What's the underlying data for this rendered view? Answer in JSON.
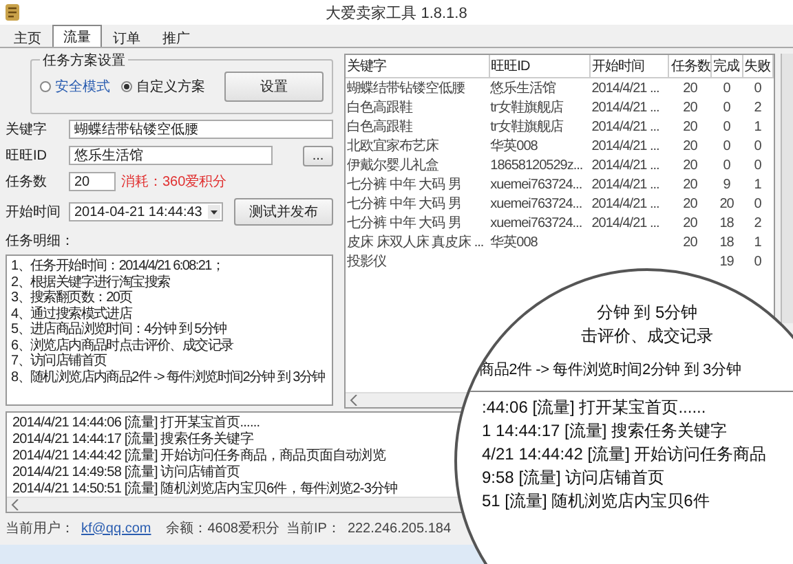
{
  "window": {
    "title": "大爱卖家工具 1.8.1.8"
  },
  "tabs": [
    {
      "label": "主页",
      "selected": false
    },
    {
      "label": "流量",
      "selected": true
    },
    {
      "label": "订单",
      "selected": false
    },
    {
      "label": "推广",
      "selected": false
    }
  ],
  "scheme": {
    "title": "任务方案设置",
    "options": [
      {
        "label": "安全模式",
        "selected": false
      },
      {
        "label": "自定义方案",
        "selected": true
      }
    ],
    "button": "设置"
  },
  "form": {
    "keyword_label": "关键字",
    "keyword": "蝴蝶结带钻镂空低腰",
    "wangwang_label": "旺旺ID",
    "wangwang": "悠乐生活馆",
    "browse_button": "...",
    "count_label": "任务数",
    "count": "20",
    "cost": "消耗：360爱积分",
    "start_label": "开始时间",
    "start_time": "2014-04-21 14:44:43",
    "publish_button": "测试并发布"
  },
  "details": {
    "label": "任务明细：",
    "lines": [
      "1、任务开始时间：2014/4/21 6:08:21；",
      "2、根据关键字进行淘宝搜索",
      "3、搜索翻页数：20页",
      "4、通过搜索模式进店",
      "5、进店商品浏览时间：4分钟 到 5分钟",
      "6、浏览店内商品时点击评价、成交记录",
      "7、访问店铺首页",
      "8、随机浏览店内商品2件 -> 每件浏览时间2分钟 到 3分钟"
    ]
  },
  "table": {
    "columns": [
      "关键字",
      "旺旺ID",
      "开始时间",
      "任务数",
      "完成",
      "失败"
    ],
    "rows": [
      {
        "keyword": "蝴蝶结带钻镂空低腰",
        "wangwang": "悠乐生活馆",
        "start_time": "2014/4/21 ...",
        "tasks": "20",
        "done": "0",
        "failed": "0"
      },
      {
        "keyword": "白色高跟鞋",
        "wangwang": "tr女鞋旗舰店",
        "start_time": "2014/4/21 ...",
        "tasks": "20",
        "done": "0",
        "failed": "2"
      },
      {
        "keyword": "白色高跟鞋",
        "wangwang": "tr女鞋旗舰店",
        "start_time": "2014/4/21 ...",
        "tasks": "20",
        "done": "0",
        "failed": "1"
      },
      {
        "keyword": "北欧宜家布艺床",
        "wangwang": "华英008",
        "start_time": "2014/4/21 ...",
        "tasks": "20",
        "done": "0",
        "failed": "0"
      },
      {
        "keyword": "伊戴尔婴儿礼盒",
        "wangwang": "18658120529z...",
        "start_time": "2014/4/21 ...",
        "tasks": "20",
        "done": "0",
        "failed": "0"
      },
      {
        "keyword": "七分裤 中年 大码 男",
        "wangwang": "xuemei763724...",
        "start_time": "2014/4/21 ...",
        "tasks": "20",
        "done": "9",
        "failed": "1"
      },
      {
        "keyword": "七分裤 中年 大码 男",
        "wangwang": "xuemei763724...",
        "start_time": "2014/4/21 ...",
        "tasks": "20",
        "done": "20",
        "failed": "0"
      },
      {
        "keyword": "七分裤 中年 大码 男",
        "wangwang": "xuemei763724...",
        "start_time": "2014/4/21 ...",
        "tasks": "20",
        "done": "18",
        "failed": "2"
      },
      {
        "keyword": "皮床 床双人床 真皮床 ...",
        "wangwang": "华英008",
        "tasks": "20",
        "done": "18",
        "failed": "1"
      },
      {
        "keyword": "投影仪",
        "done": "19",
        "failed": "0"
      }
    ]
  },
  "log": {
    "lines": [
      "2014/4/21 14:44:06 [流量] 打开某宝首页......",
      "2014/4/21 14:44:17 [流量] 搜索任务关键字",
      "2014/4/21 14:44:42 [流量] 开始访问任务商品，商品页面自动浏览",
      "2014/4/21 14:49:58 [流量] 访问店铺首页",
      "2014/4/21 14:50:51 [流量] 随机浏览店内宝贝6件，每件浏览2-3分钟"
    ]
  },
  "magnifier": {
    "detail_lines": [
      "分钟 到 5分钟",
      "击评价、成交记录",
      "商品2件 -> 每件浏览时间2分钟 到 3分钟"
    ],
    "log_lines": [
      ":44:06 [流量] 打开某宝首页......",
      "1 14:44:17 [流量] 搜索任务关键字",
      "4/21 14:44:42 [流量] 开始访问任务商品",
      "9:58 [流量] 访问店铺首页",
      "51 [流量] 随机浏览店内宝贝6件"
    ]
  },
  "status_bar": {
    "user_label": "当前用户：",
    "user": "kf@qq.com",
    "balance": "余额：4608爱积分",
    "ip_label": "当前IP：",
    "ip": "222.246.205.184"
  }
}
